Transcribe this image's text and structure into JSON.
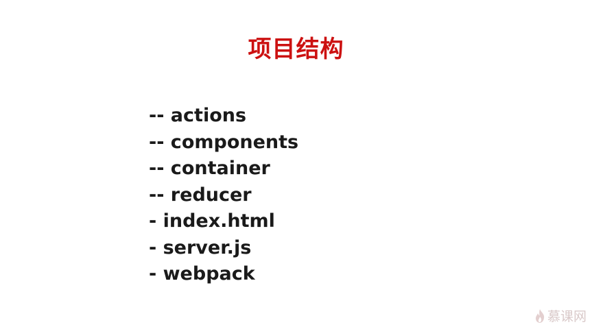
{
  "slide": {
    "title": "项目结构",
    "items": [
      "-- actions",
      "-- components",
      "-- container",
      "-- reducer",
      "- index.html",
      "- server.js",
      "- webpack"
    ]
  },
  "watermark": {
    "text": "慕课网",
    "icon": "flame-icon"
  },
  "colors": {
    "title": "#cc1111",
    "text": "#1a1a1a",
    "watermark": "#d9c9c9"
  }
}
